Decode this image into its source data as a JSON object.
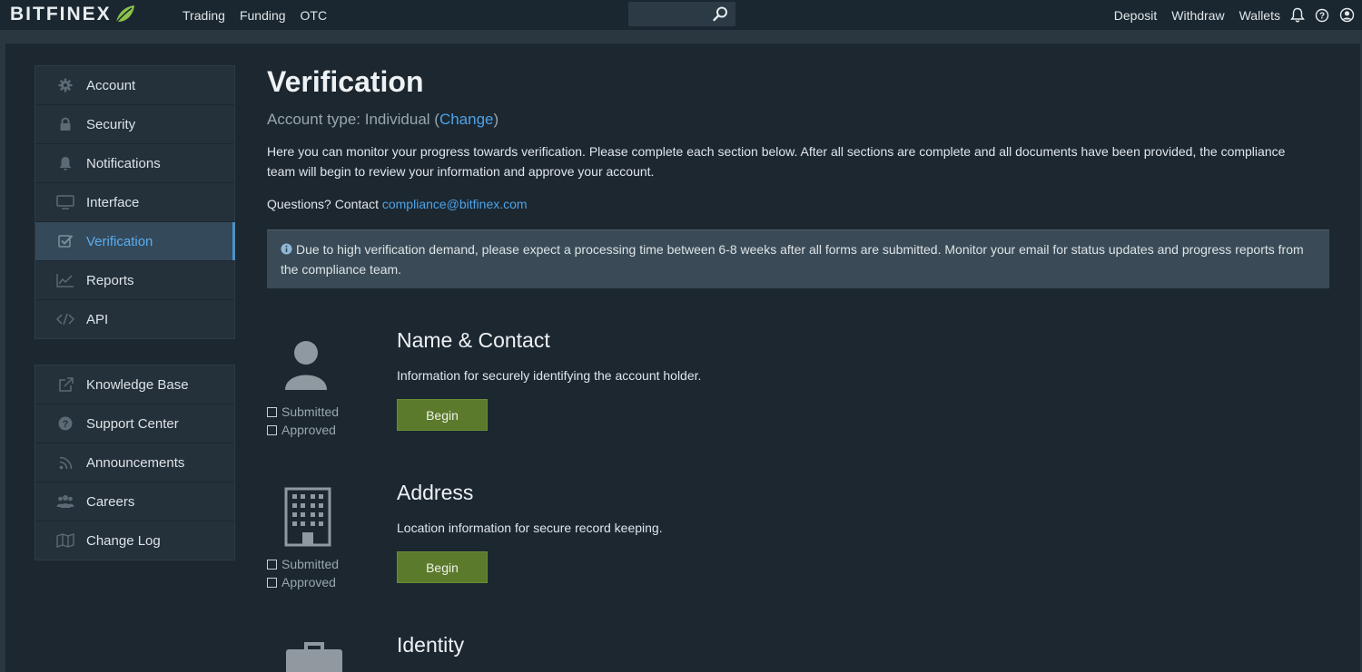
{
  "app": {
    "logo_text": "BITFINEX",
    "brand_color": "#7cb342"
  },
  "topnav": {
    "items": [
      "Trading",
      "Funding",
      "OTC"
    ]
  },
  "search": {
    "placeholder": "",
    "icon": "search-icon"
  },
  "rightnav": {
    "items": [
      "Deposit",
      "Withdraw",
      "Wallets"
    ],
    "icons": [
      "bell-icon",
      "help-icon",
      "user-circle-icon"
    ]
  },
  "sidebar": {
    "group1": [
      {
        "label": "Account",
        "icon": "gear-icon"
      },
      {
        "label": "Security",
        "icon": "lock-icon"
      },
      {
        "label": "Notifications",
        "icon": "bell-icon"
      },
      {
        "label": "Interface",
        "icon": "monitor-icon"
      },
      {
        "label": "Verification",
        "icon": "check-square-icon",
        "active": true
      },
      {
        "label": "Reports",
        "icon": "line-chart-icon"
      },
      {
        "label": "API",
        "icon": "code-icon"
      }
    ],
    "group2": [
      {
        "label": "Knowledge Base",
        "icon": "external-link-icon"
      },
      {
        "label": "Support Center",
        "icon": "question-circle-icon"
      },
      {
        "label": "Announcements",
        "icon": "rss-icon"
      },
      {
        "label": "Careers",
        "icon": "users-icon"
      },
      {
        "label": "Change Log",
        "icon": "map-icon"
      }
    ]
  },
  "main": {
    "title": "Verification",
    "account_type_prefix": "Account type: Individual (",
    "account_type_change": "Change",
    "account_type_suffix": ")",
    "intro": "Here you can monitor your progress towards verification. Please complete each section below. After all sections are complete and all documents have been provided, the compliance team will begin to review your information and approve your account.",
    "questions_prefix": "Questions? Contact ",
    "questions_email": "compliance@bitfinex.com",
    "notice": "Due to high verification demand, please expect a processing time between 6-8 weeks after all forms are submitted. Monitor your email for status updates and progress reports from the compliance team."
  },
  "sections": [
    {
      "title": "Name & Contact",
      "desc": "Information for securely identifying the account holder.",
      "icon": "user-icon",
      "submitted_label": "Submitted",
      "approved_label": "Approved",
      "button": "Begin"
    },
    {
      "title": "Address",
      "desc": "Location information for secure record keeping.",
      "icon": "building-icon",
      "submitted_label": "Submitted",
      "approved_label": "Approved",
      "button": "Begin"
    },
    {
      "title": "Identity",
      "icon": "briefcase-icon"
    }
  ]
}
